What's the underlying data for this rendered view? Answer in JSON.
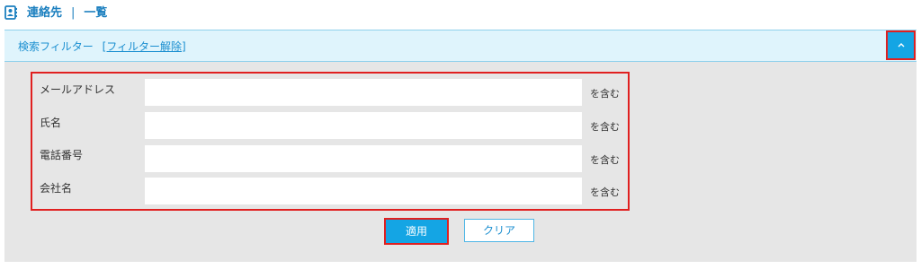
{
  "header": {
    "section": "連絡先",
    "separator": "|",
    "view": "一覧",
    "icon": "contact-card-icon"
  },
  "filter": {
    "title": "検索フィルター",
    "clear_link": "[フィルター解除]",
    "collapse_icon": "chevron-up-icon",
    "fields": [
      {
        "label": "メールアドレス",
        "value": "",
        "suffix": "を含む"
      },
      {
        "label": "氏名",
        "value": "",
        "suffix": "を含む"
      },
      {
        "label": "電話番号",
        "value": "",
        "suffix": "を含む"
      },
      {
        "label": "会社名",
        "value": "",
        "suffix": "を含む"
      }
    ],
    "apply_label": "適用",
    "clear_label": "クリア"
  },
  "colors": {
    "accent": "#14a5e4",
    "link": "#1b8fd0",
    "highlight_border": "#e02020",
    "bar_background": "#dff4fc",
    "panel_background": "#e6e6e6"
  }
}
